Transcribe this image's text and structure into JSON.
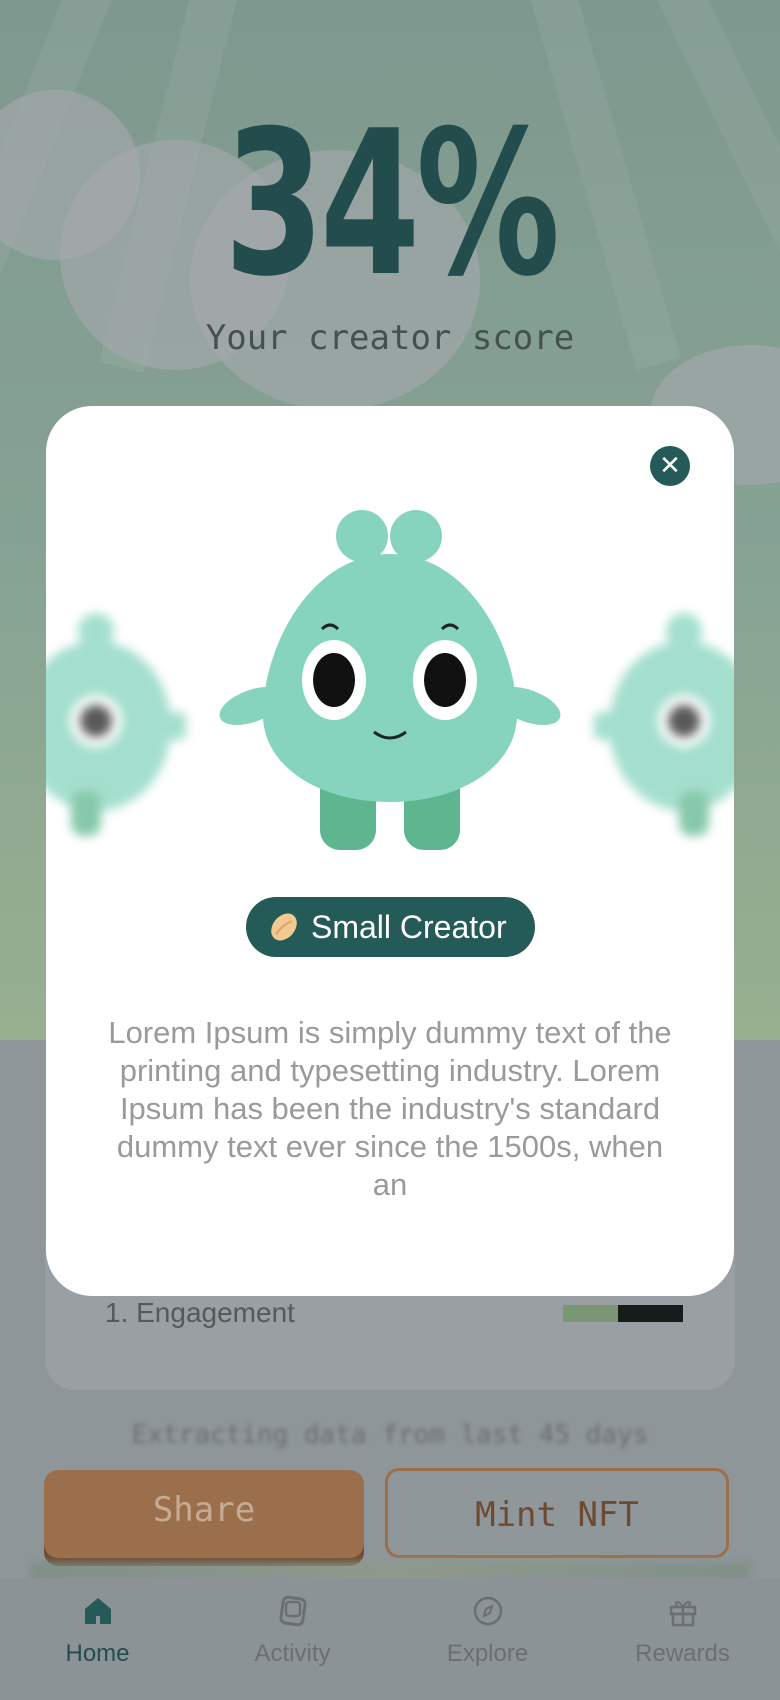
{
  "background": {
    "score_value": "34%",
    "score_subtitle": "Your creator score",
    "metrics": [
      {
        "label": "1. Engagement",
        "level": 0.46
      }
    ],
    "status_text": "Extracting data from last 45 days",
    "share_label": "Share",
    "mint_label": "Mint NFT"
  },
  "modal": {
    "close_icon": "close-icon",
    "badge_icon": "seed-icon",
    "badge_label": "Small Creator",
    "description": "Lorem Ipsum is simply dummy text of the printing and typesetting industry. Lorem Ipsum has been the industry's standard dummy text ever since the 1500s, when an"
  },
  "tabbar": {
    "items": [
      {
        "label": "Home",
        "icon": "home-icon",
        "active": true
      },
      {
        "label": "Activity",
        "icon": "activity-icon",
        "active": false
      },
      {
        "label": "Explore",
        "icon": "compass-icon",
        "active": false
      },
      {
        "label": "Rewards",
        "icon": "gift-icon",
        "active": false
      }
    ]
  },
  "colors": {
    "accent": "#245a58",
    "brown": "#9c6f4c",
    "mascot": "#86d4bd",
    "mascot_leg": "#5eb690"
  }
}
